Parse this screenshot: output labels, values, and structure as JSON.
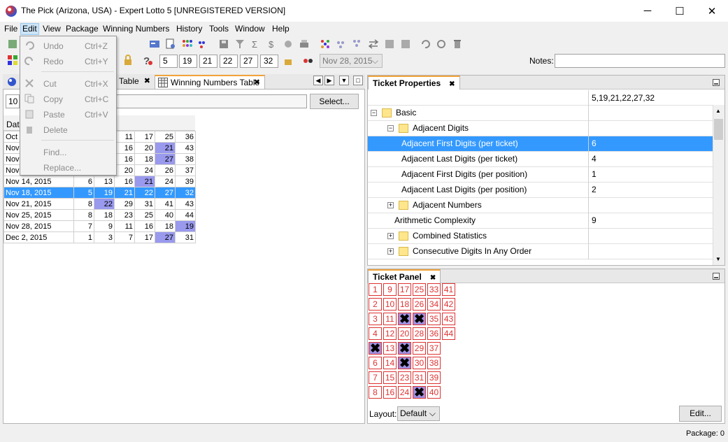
{
  "window": {
    "title": "The Pick (Arizona, USA) - Expert Lotto 5 [UNREGISTERED VERSION]",
    "minimize": "─",
    "maximize": "☐",
    "close": "✕"
  },
  "menubar": [
    "File",
    "Edit",
    "View",
    "Package",
    "Winning Numbers",
    "History",
    "Tools",
    "Window",
    "Help"
  ],
  "edit_menu": {
    "items": [
      {
        "label": "Undo",
        "shortcut": "Ctrl+Z"
      },
      {
        "label": "Redo",
        "shortcut": "Ctrl+Y"
      },
      {
        "label": "Cut",
        "shortcut": "Ctrl+X"
      },
      {
        "label": "Copy",
        "shortcut": "Ctrl+C"
      },
      {
        "label": "Paste",
        "shortcut": "Ctrl+V"
      },
      {
        "label": "Delete",
        "shortcut": ""
      },
      {
        "label": "Find...",
        "shortcut": ""
      },
      {
        "label": "Replace...",
        "shortcut": ""
      }
    ]
  },
  "toolbar": {
    "numbers": [
      "5",
      "19",
      "21",
      "22",
      "27",
      "32"
    ],
    "date": "Nov 28, 2015",
    "notes_label": "Notes:",
    "notes_value": ""
  },
  "left_pane": {
    "tab_partial_label": "Table",
    "tab_active_label": "Winning Numbers Table",
    "row_count": "10",
    "select_button": "Select...",
    "column_header_date": "Dat",
    "rows": [
      {
        "date": "Oct 3",
        "n": [
          "",
          "",
          "11",
          "17",
          "25",
          "36"
        ],
        "hl": []
      },
      {
        "date": "Nov",
        "n": [
          "",
          "",
          "16",
          "20",
          "21",
          "43"
        ],
        "hl": [
          4
        ]
      },
      {
        "date": "Nov",
        "n": [
          "",
          "",
          "16",
          "18",
          "27",
          "38"
        ],
        "hl": [
          4
        ]
      },
      {
        "date": "Nov",
        "n": [
          "",
          "",
          "20",
          "24",
          "26",
          "37"
        ],
        "hl": []
      },
      {
        "date": "Nov 14, 2015",
        "n": [
          "6",
          "13",
          "16",
          "21",
          "24",
          "39"
        ],
        "hl": [
          3
        ]
      },
      {
        "date": "Nov 18, 2015",
        "n": [
          "5",
          "19",
          "21",
          "22",
          "27",
          "32"
        ],
        "hl": [],
        "selected": true
      },
      {
        "date": "Nov 21, 2015",
        "n": [
          "8",
          "22",
          "29",
          "31",
          "41",
          "43"
        ],
        "hl": [
          1
        ]
      },
      {
        "date": "Nov 25, 2015",
        "n": [
          "8",
          "18",
          "23",
          "25",
          "40",
          "44"
        ],
        "hl": []
      },
      {
        "date": "Nov 28, 2015",
        "n": [
          "7",
          "9",
          "11",
          "16",
          "18",
          "19"
        ],
        "hl": [
          5
        ]
      },
      {
        "date": "Dec 2, 2015",
        "n": [
          "1",
          "3",
          "7",
          "17",
          "27",
          "31"
        ],
        "hl": [
          4
        ]
      }
    ]
  },
  "ticket_properties": {
    "title": "Ticket Properties",
    "header_value": "5,19,21,22,27,32",
    "rows": [
      {
        "name": "Basic",
        "value": "",
        "indent": 0,
        "folder": true,
        "expander": "−"
      },
      {
        "name": "Adjacent Digits",
        "value": "",
        "indent": 1,
        "folder": true,
        "expander": "−"
      },
      {
        "name": "Adjacent First Digits (per ticket)",
        "value": "6",
        "indent": 2,
        "selected": true
      },
      {
        "name": "Adjacent Last Digits (per ticket)",
        "value": "4",
        "indent": 2
      },
      {
        "name": "Adjacent First Digits (per position)",
        "value": "1",
        "indent": 2
      },
      {
        "name": "Adjacent Last Digits (per position)",
        "value": "2",
        "indent": 2
      },
      {
        "name": "Adjacent Numbers",
        "value": "",
        "indent": 1,
        "folder": true,
        "expander": "+"
      },
      {
        "name": "Arithmetic Complexity",
        "value": "9",
        "indent": 1
      },
      {
        "name": "Combined Statistics",
        "value": "",
        "indent": 1,
        "folder": true,
        "expander": "+"
      },
      {
        "name": "Consecutive Digits In Any Order",
        "value": "",
        "indent": 1,
        "folder": true,
        "expander": "+"
      }
    ]
  },
  "ticket_panel": {
    "title": "Ticket Panel",
    "columns": [
      [
        "1",
        "2",
        "3",
        "4",
        "5",
        "6",
        "7",
        "8"
      ],
      [
        "9",
        "10",
        "11",
        "12",
        "13",
        "14",
        "15",
        "16"
      ],
      [
        "17",
        "18",
        "19",
        "20",
        "21",
        "22",
        "23",
        "24"
      ],
      [
        "25",
        "26",
        "27",
        "28",
        "29",
        "30",
        "31",
        "32"
      ],
      [
        "33",
        "34",
        "35",
        "36",
        "37",
        "38",
        "39",
        "40"
      ],
      [
        "41",
        "42",
        "43",
        "44"
      ]
    ],
    "marked": [
      "5",
      "19",
      "21",
      "22",
      "27",
      "32"
    ],
    "mark_glyph": "✖",
    "layout_label": "Layout:",
    "layout_value": "Default",
    "edit_button": "Edit..."
  },
  "status": {
    "package": "Package: 0"
  }
}
